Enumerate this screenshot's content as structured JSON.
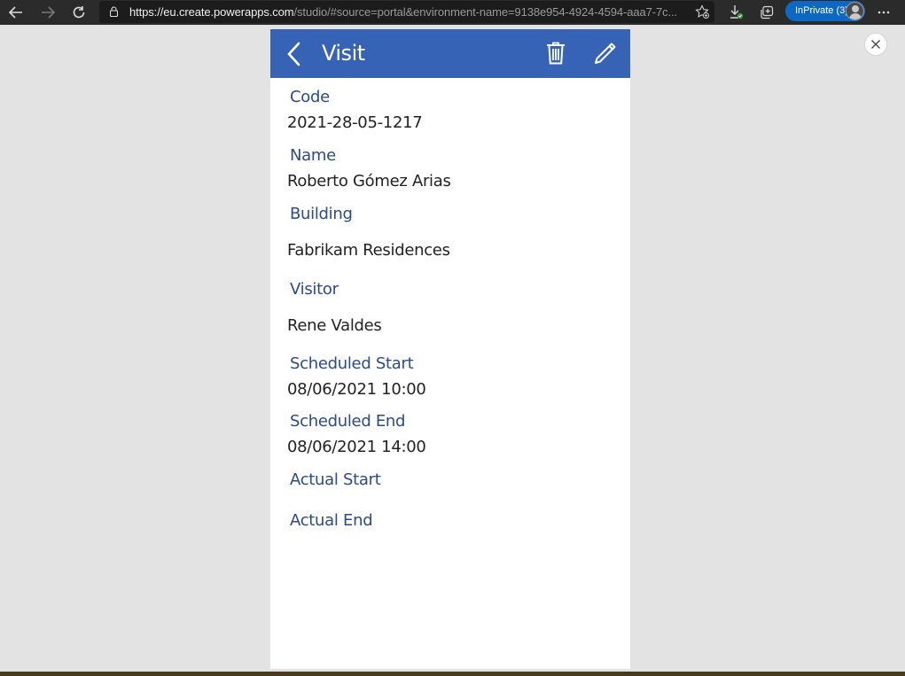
{
  "browser": {
    "url_host": "https://eu.create.powerapps.com",
    "url_rest": "/studio/#source=portal&environment-name=9138e954-4924-4594-aaa7-7c...",
    "inprivate_label": "InPrivate (3)",
    "icons": {
      "back": "arrow-left-icon",
      "forward": "arrow-right-icon",
      "refresh": "refresh-icon",
      "lock": "lock-icon",
      "favorites": "star-add-icon",
      "downloads": "download-icon",
      "collections": "collections-icon",
      "more": "more-icon"
    },
    "inprivate_color": "#0f67c4"
  },
  "app": {
    "header": {
      "title": "Visit",
      "background": "#3763b6",
      "icons": {
        "back": "chevron-left-icon",
        "delete": "trash-icon",
        "edit": "pencil-icon"
      }
    },
    "label_color": "#2b4a8c",
    "fields": [
      {
        "label": "Code",
        "value": "2021-28-05-1217"
      },
      {
        "label": "Name",
        "value": "Roberto Gómez Arias"
      },
      {
        "label": "Building",
        "value": "Fabrikam Residences"
      },
      {
        "label": "Visitor",
        "value": "Rene Valdes"
      },
      {
        "label": "Scheduled Start",
        "value": "08/06/2021 10:00"
      },
      {
        "label": "Scheduled End",
        "value": "08/06/2021 14:00"
      },
      {
        "label": "Actual Start",
        "value": ""
      },
      {
        "label": "Actual End",
        "value": ""
      }
    ]
  },
  "close_icon": "close-icon"
}
